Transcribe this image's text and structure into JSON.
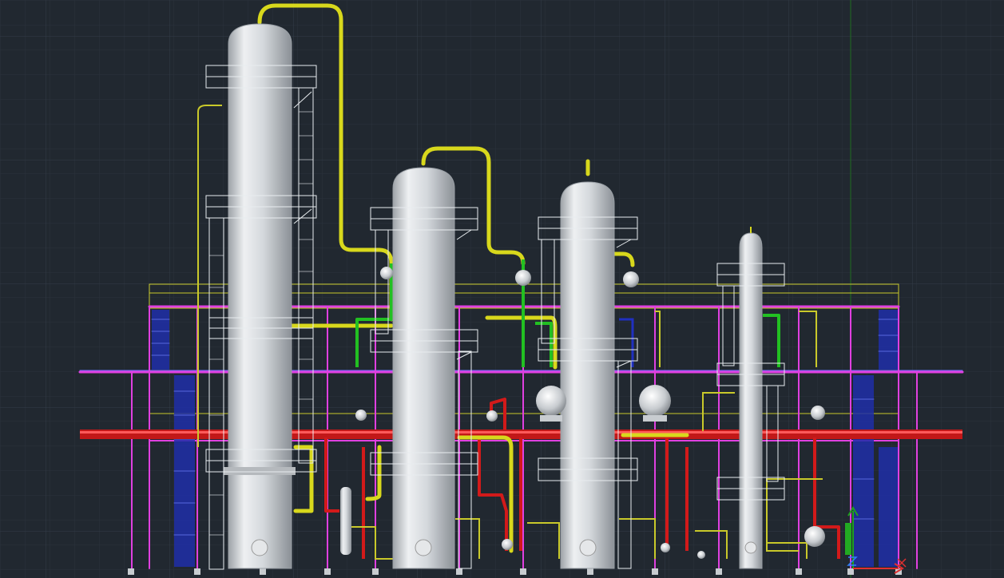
{
  "viewport": {
    "background": "#212830",
    "grid_minor_color": "#2a323c",
    "grid_major_color": "#333d48"
  },
  "colors": {
    "vessel_body": "#d2d6da",
    "steel_frame": "#ffffff",
    "yellow_pipe": "#d8d81c",
    "magenta_steel": "#e040e0",
    "red_pipe": "#d21a1a",
    "green_pipe": "#22c022",
    "blue_ladder": "#1e2ea8",
    "ucs_y_axis": "#1fa01f",
    "ucs_x_axis": "#e03030"
  },
  "icons": {
    "ucs_icon": "ucs-icon"
  },
  "objects": {
    "columns": [
      "column-t1",
      "column-t2",
      "column-t3",
      "column-t4"
    ],
    "drums": [
      "drum-1",
      "drum-2"
    ]
  }
}
